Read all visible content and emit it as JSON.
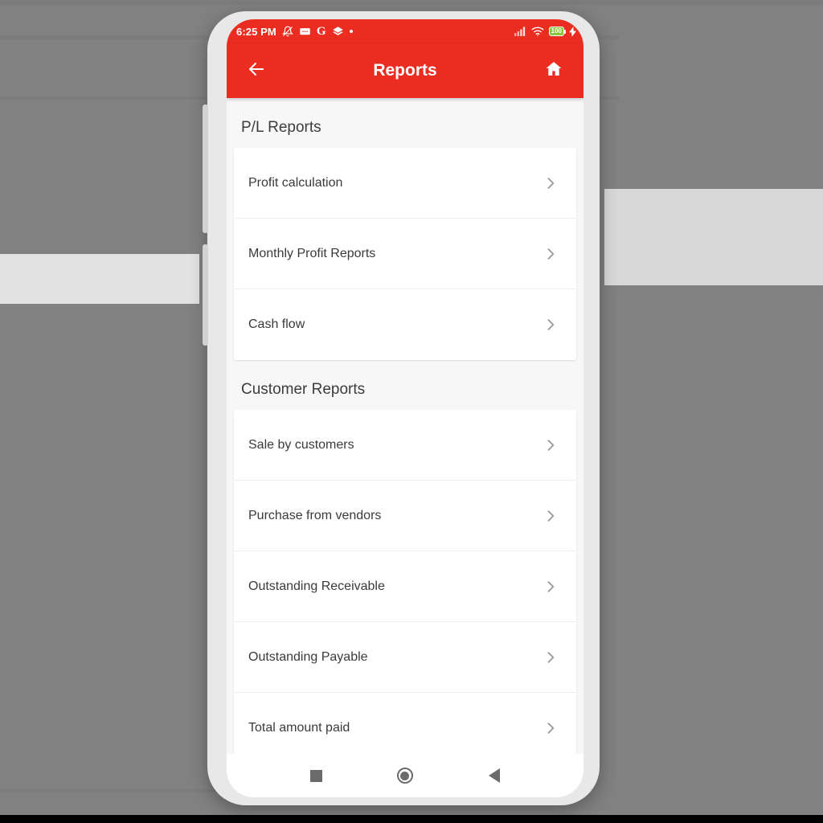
{
  "statusbar": {
    "time": "6:25 PM",
    "battery_level": "100",
    "icons": [
      "bell-muted-icon",
      "message-icon",
      "google-g-icon",
      "layers-icon",
      "dot-icon"
    ],
    "right_icons": [
      "signal-bars-icon",
      "wifi-icon",
      "battery-icon",
      "charging-bolt-icon"
    ]
  },
  "appbar": {
    "title": "Reports",
    "back_icon": "back-arrow-icon",
    "home_icon": "home-icon",
    "background_color": "#ea2c21"
  },
  "sections": [
    {
      "header": "P/L Reports",
      "items": [
        {
          "label": "Profit calculation"
        },
        {
          "label": "Monthly Profit Reports"
        },
        {
          "label": "Cash flow"
        }
      ]
    },
    {
      "header": "Customer Reports",
      "items": [
        {
          "label": "Sale by customers"
        },
        {
          "label": "Purchase from vendors"
        },
        {
          "label": "Outstanding Receivable"
        },
        {
          "label": "Outstanding Payable"
        },
        {
          "label": "Total amount paid"
        }
      ]
    }
  ],
  "navbar": {
    "recents": "recents-square-icon",
    "home": "home-circle-icon",
    "back": "back-triangle-icon"
  },
  "colors": {
    "accent": "#ea2c21",
    "page_background": "#818181",
    "card": "#ffffff",
    "content_background": "#f7f7f7",
    "battery_green": "#8cc63f"
  }
}
